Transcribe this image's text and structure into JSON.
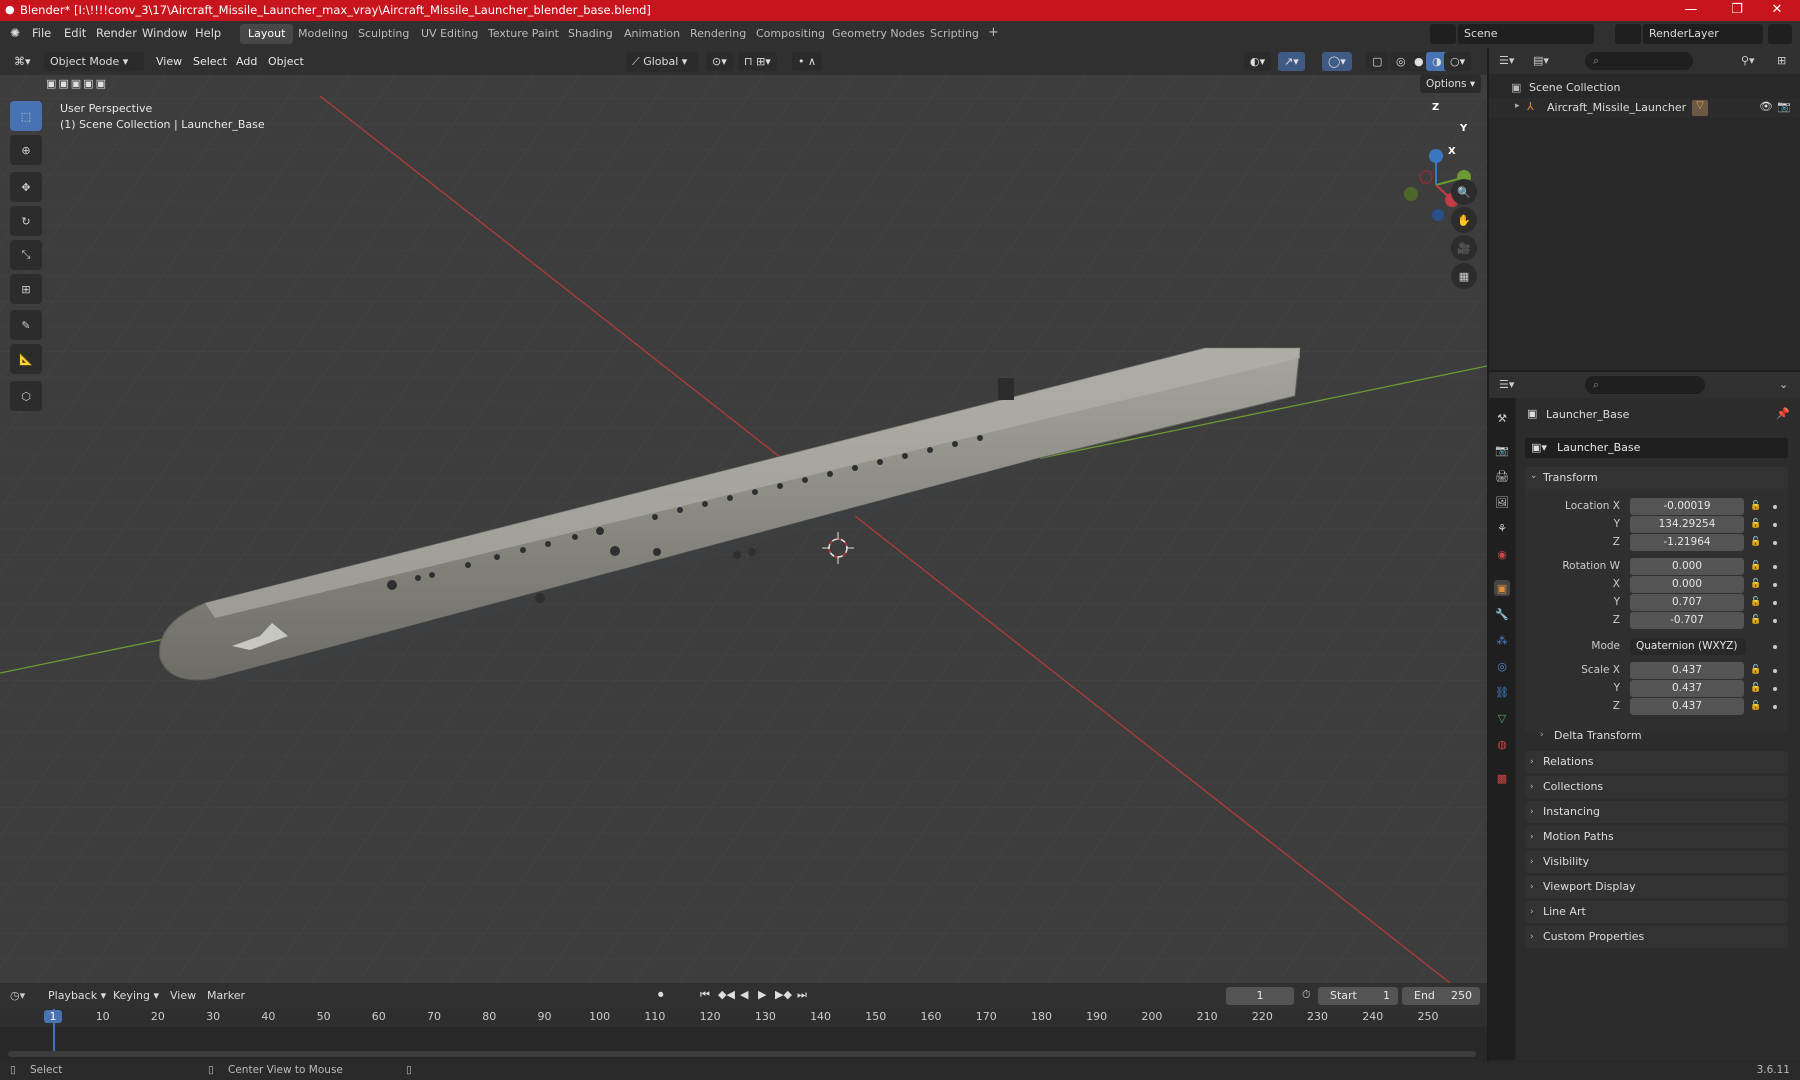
{
  "window": {
    "title": "Blender* [I:\\!!!!conv_3\\17\\Aircraft_Missile_Launcher_max_vray\\Aircraft_Missile_Launcher_blender_base.blend]",
    "minimize": "—",
    "maximize": "❐",
    "close": "✕"
  },
  "menus": [
    "File",
    "Edit",
    "Render",
    "Window",
    "Help"
  ],
  "workspaces": [
    "Layout",
    "Modeling",
    "Sculpting",
    "UV Editing",
    "Texture Paint",
    "Shading",
    "Animation",
    "Rendering",
    "Compositing",
    "Geometry Nodes",
    "Scripting"
  ],
  "workspace_add": "+",
  "scene": {
    "label": "Scene",
    "render_layer": "RenderLayer"
  },
  "viewport": {
    "mode": "Object Mode",
    "menus": [
      "View",
      "Select",
      "Add",
      "Object"
    ],
    "orientation": "Global",
    "options_label": "Options",
    "perspective": "User Perspective",
    "collection_info": "(1) Scene Collection | Launcher_Base",
    "gizmo": {
      "x": "X",
      "y": "Y",
      "z": "Z"
    },
    "object_color": "#8a8a82"
  },
  "outliner": {
    "root": "Scene Collection",
    "items": [
      {
        "name": "Aircraft_Missile_Launcher"
      }
    ]
  },
  "properties": {
    "object_name": "Launcher_Base",
    "data_name": "Launcher_Base",
    "transform_title": "Transform",
    "location": {
      "label": "Location X",
      "x": "-0.00019",
      "y": "134.29254",
      "z": "-1.21964"
    },
    "rotation": {
      "label": "Rotation W",
      "w": "0.000",
      "x": "0.000",
      "y": "0.707",
      "z": "-0.707"
    },
    "mode": {
      "label": "Mode",
      "value": "Quaternion (WXYZ)"
    },
    "scale": {
      "label": "Scale X",
      "x": "0.437",
      "y": "0.437",
      "z": "0.437"
    },
    "axis_labels": {
      "y": "Y",
      "z": "Z",
      "x": "X"
    },
    "delta_transform": "Delta Transform",
    "panels": [
      "Relations",
      "Collections",
      "Instancing",
      "Motion Paths",
      "Visibility",
      "Viewport Display",
      "Line Art",
      "Custom Properties"
    ]
  },
  "timeline": {
    "menus": [
      "Playback",
      "Keying",
      "View",
      "Marker"
    ],
    "current_frame": "1",
    "start_label": "Start",
    "start": "1",
    "end_label": "End",
    "end": "250",
    "ticks": [
      "1",
      "10",
      "20",
      "30",
      "40",
      "50",
      "60",
      "70",
      "80",
      "90",
      "100",
      "110",
      "120",
      "130",
      "140",
      "150",
      "160",
      "170",
      "180",
      "190",
      "200",
      "210",
      "220",
      "230",
      "240",
      "250"
    ]
  },
  "status": {
    "select": "Select",
    "center_view": "Center View to Mouse",
    "version": "3.6.11"
  },
  "colors": {
    "accent": "#4772b3",
    "title_bar": "#c8141c",
    "x_axis": "#b23b3b",
    "y_axis": "#6b9a34",
    "z_axis": "#3b76c2"
  }
}
